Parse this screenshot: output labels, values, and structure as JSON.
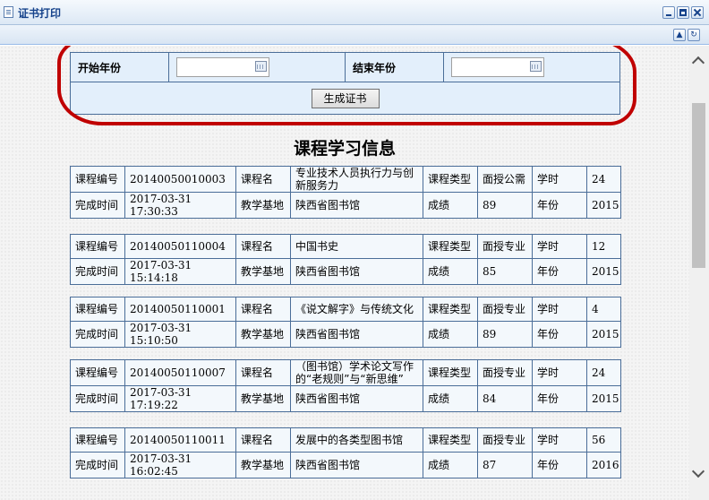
{
  "window": {
    "title": "证书打印"
  },
  "search": {
    "start_label": "开始年份",
    "end_label": "结束年份",
    "start_value": "",
    "end_value": "",
    "generate_label": "生成证书"
  },
  "section_title": "课程学习信息",
  "labels": {
    "course_no": "课程编号",
    "course_name": "课程名",
    "course_type": "课程类型",
    "hours": "学时",
    "finish_time": "完成时间",
    "base": "教学基地",
    "score": "成绩",
    "year": "年份"
  },
  "records": [
    {
      "no": "20140050010003",
      "name": "专业技术人员执行力与创新服务力",
      "type": "面授公需",
      "hours": "24",
      "time": "2017-03-31 17:30:33",
      "base": "陕西省图书馆",
      "score": "89",
      "year": "2015"
    },
    {
      "no": "20140050110004",
      "name": "中国书史",
      "type": "面授专业",
      "hours": "12",
      "time": "2017-03-31 15:14:18",
      "base": "陕西省图书馆",
      "score": "85",
      "year": "2015"
    },
    {
      "no": "20140050110001",
      "name": "《说文解字》与传统文化",
      "type": "面授专业",
      "hours": "4",
      "time": "2017-03-31 15:10:50",
      "base": "陕西省图书馆",
      "score": "89",
      "year": "2015"
    },
    {
      "no": "20140050110007",
      "name": "（图书馆）学术论文写作的“老规则”与“新思维”",
      "type": "面授专业",
      "hours": "24",
      "time": "2017-03-31 17:19:22",
      "base": "陕西省图书馆",
      "score": "84",
      "year": "2015"
    },
    {
      "no": "20140050110011",
      "name": "发展中的各类型图书馆",
      "type": "面授专业",
      "hours": "56",
      "time": "2017-03-31 16:02:45",
      "base": "陕西省图书馆",
      "score": "87",
      "year": "2016"
    }
  ]
}
